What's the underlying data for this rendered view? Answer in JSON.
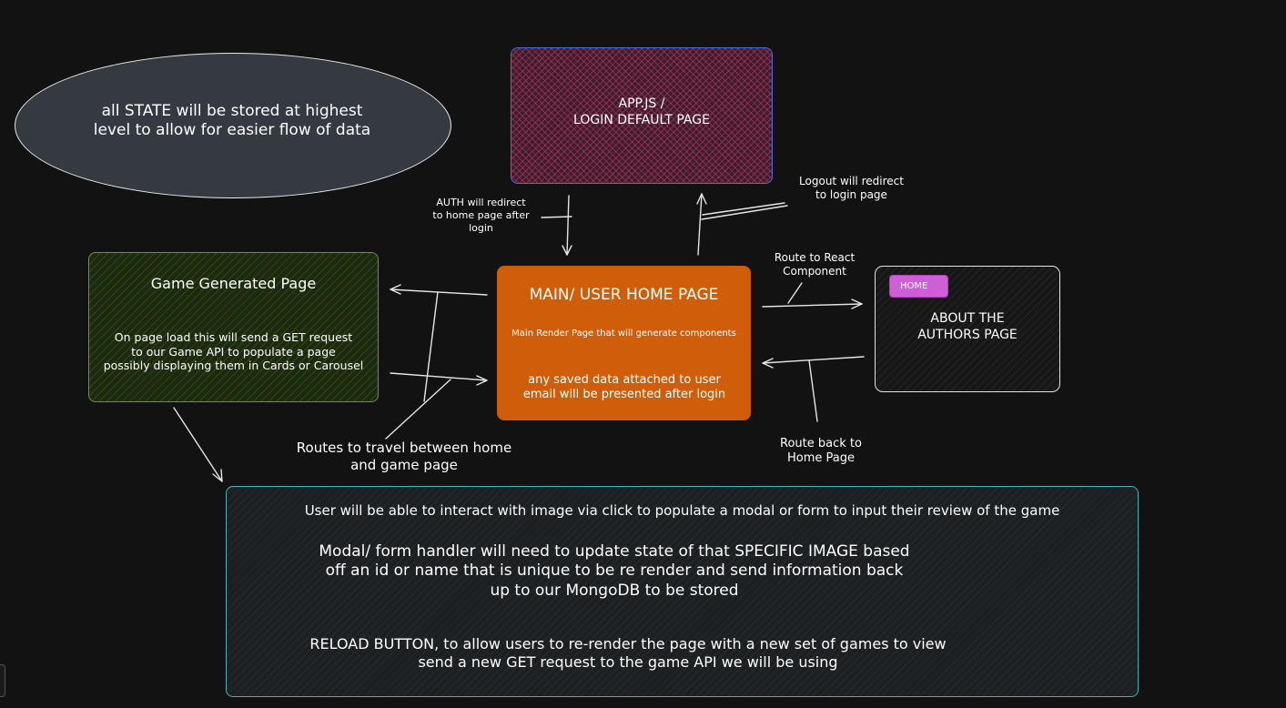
{
  "state_note": {
    "line1": "all STATE will be stored at highest",
    "line2": "level to allow for easier flow of data"
  },
  "login_page": {
    "line1": "APP.JS /",
    "line2": "LOGIN DEFAULT PAGE"
  },
  "main_page": {
    "title": "MAIN/ USER HOME PAGE",
    "subtitle": "Main Render Page that will generate components",
    "desc_line1": "any saved data attached to user",
    "desc_line2": "email will be presented after login"
  },
  "game_page": {
    "title": "Game Generated Page",
    "desc_line1": "On page load this will send a GET request",
    "desc_line2": "to our Game API to populate a page",
    "desc_line3": "possibly displaying them in Cards or Carousel"
  },
  "about_page": {
    "home_button": "HOME",
    "line1": "ABOUT THE",
    "line2": "AUTHORS PAGE"
  },
  "labels": {
    "auth_line1": "AUTH will redirect",
    "auth_line2": "to home page after",
    "auth_line3": "login",
    "logout_line1": "Logout will redirect",
    "logout_line2": "to login page",
    "route_react_line1": "Route to React",
    "route_react_line2": "Component",
    "route_back_line1": "Route back to",
    "route_back_line2": "Home Page",
    "routes_line1": "Routes to travel between home",
    "routes_line2": "and game page"
  },
  "notes": {
    "line1": "User will be able to interact with image via click to populate a modal or form to input their review of the game",
    "line2a": "Modal/ form handler will need to update state of that SPECIFIC IMAGE based",
    "line2b": "off an id or name that is unique to be re render and send information back",
    "line2c": "up to our MongoDB to be stored",
    "line3a": "RELOAD BUTTON, to allow users to re-render the page with a new set of games to view",
    "line3b": "send a new GET request to the game API we will be using"
  },
  "colors": {
    "background": "#121212",
    "login_border": "#4a6fd8",
    "main_fill": "#cf5d09",
    "game_border": "#6a9a2a",
    "notes_border": "#3fb3bd",
    "home_button": "#cf5ed8"
  }
}
